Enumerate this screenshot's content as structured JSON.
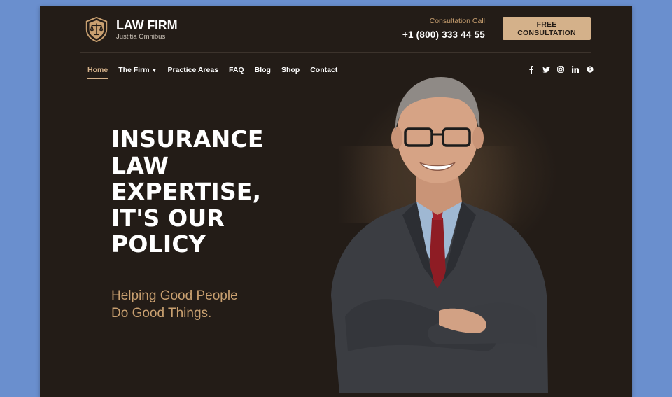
{
  "header": {
    "logo_title": "LAW FIRM",
    "logo_subtitle": "Justitia Omnibus",
    "contact_label": "Consultation Call",
    "contact_phone": "+1 (800) 333 44 55",
    "cta_label": "FREE CONSULTATION"
  },
  "nav": {
    "items": [
      {
        "label": "Home",
        "active": true
      },
      {
        "label": "The Firm",
        "has_dropdown": true
      },
      {
        "label": "Practice Areas"
      },
      {
        "label": "FAQ"
      },
      {
        "label": "Blog"
      },
      {
        "label": "Shop"
      },
      {
        "label": "Contact"
      }
    ],
    "social_icons": [
      "facebook-icon",
      "twitter-icon",
      "instagram-icon",
      "linkedin-icon",
      "skype-icon"
    ]
  },
  "hero": {
    "headline_lines": [
      "INSURANCE",
      "LAW",
      "EXPERTISE,",
      "IT'S OUR",
      "POLICY"
    ],
    "subhead_lines": [
      "Helping Good People",
      "Do Good Things."
    ]
  },
  "colors": {
    "page_background": "#6a8fce",
    "frame_background": "#231c17",
    "accent_gold": "#d4b18a",
    "accent_text": "#c9a070",
    "text_white": "#ffffff"
  }
}
